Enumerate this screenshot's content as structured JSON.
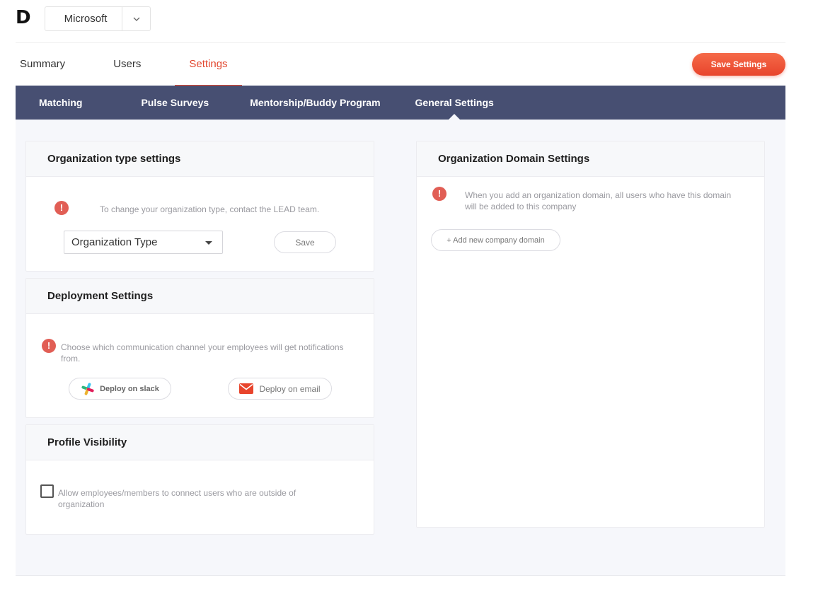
{
  "header": {
    "logo": "D",
    "company": "Microsoft"
  },
  "main_tabs": [
    {
      "label": "Summary"
    },
    {
      "label": "Users"
    },
    {
      "label": "Settings",
      "active": true
    }
  ],
  "save_settings_label": "Save Settings",
  "sub_nav": [
    {
      "label": "Matching"
    },
    {
      "label": "Pulse Surveys"
    },
    {
      "label": "Mentorship/Buddy Program"
    },
    {
      "label": "General Settings",
      "active": true
    }
  ],
  "org_type": {
    "title": "Organization type settings",
    "note": "To change your organization type, contact the LEAD team.",
    "select_value": "Organization Type",
    "save_label": "Save"
  },
  "deployment": {
    "title": "Deployment Settings",
    "note": "Choose which communication channel your employees will get notifications from.",
    "slack_label": "Deploy on slack",
    "email_label": "Deploy on email"
  },
  "profile": {
    "title": "Profile Visibility",
    "checkbox_label": "Allow employees/members to connect users who are outside of organization",
    "checked": false
  },
  "domain": {
    "title": "Organization Domain Settings",
    "note": "When you add an organization domain, all users who have this domain will be added to this company",
    "add_label": "+ Add new company domain"
  },
  "colors": {
    "accent": "#e2462e",
    "nav_bg": "#474f72",
    "alert": "#e15e55"
  }
}
